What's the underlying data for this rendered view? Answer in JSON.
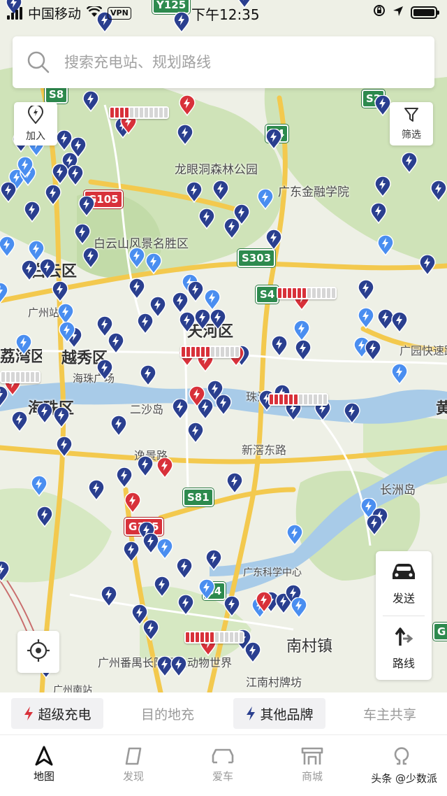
{
  "status_bar": {
    "carrier": "中国移动",
    "vpn": "VPN",
    "time": "下午12:35"
  },
  "search": {
    "placeholder": "搜索充电站、规划路线"
  },
  "map_controls": {
    "add_label": "加入",
    "filter_label": "筛选",
    "send_label": "发送",
    "route_label": "路线"
  },
  "map_labels": {
    "longyan": "龙眼洞森林公园",
    "finance": "广东金融学院",
    "baiyun_mt": "白云山风景名胜区",
    "baiyun_district": "白云区",
    "guangzhou_station": "广州站",
    "tianhe": "天河区",
    "yuexiu": "越秀区",
    "liwan": "荔湾区",
    "haixin": "海珠广场",
    "ershadao": "二沙岛",
    "zhujiang": "珠江",
    "haizhu": "海珠区",
    "xingang": "新滘东路",
    "yijing": "逸景路",
    "guangyuan": "广园快速路",
    "huangpu": "黄",
    "changzhou": "长洲岛",
    "science": "广东科学中心",
    "nancun": "南村镇",
    "chimelong": "广州番禺长隆野生动物世界",
    "jiangnan": "江南村牌坊",
    "guangzhou_south": "广州南站"
  },
  "road_shields": [
    "S8",
    "S2",
    "S4",
    "G105",
    "S303",
    "S4",
    "S81",
    "G105",
    "S4",
    "G",
    "Y125"
  ],
  "filters": [
    {
      "label": "超级充电",
      "active": true,
      "bolt": true
    },
    {
      "label": "目的地充",
      "active": false,
      "bolt": false
    },
    {
      "label": "其他品牌",
      "active": true,
      "bolt": true
    },
    {
      "label": "车主共享",
      "active": false,
      "bolt": false
    }
  ],
  "tabs": [
    {
      "label": "地图",
      "active": true,
      "icon": "map-nav-icon"
    },
    {
      "label": "发现",
      "active": false,
      "icon": "discover-icon"
    },
    {
      "label": "爱车",
      "active": false,
      "icon": "car-icon"
    },
    {
      "label": "商城",
      "active": false,
      "icon": "shop-icon"
    },
    {
      "label": "",
      "active": false,
      "icon": "profile-icon"
    }
  ],
  "watermark": "头条 @少数派",
  "colors": {
    "supercharger_pin": "#d8313a",
    "other_pin_dark": "#2a3f8f",
    "other_pin_light": "#4a8ef0",
    "road_yellow": "#f5c84a",
    "green_area": "#c9e0b2",
    "water": "#9fc6e8"
  }
}
